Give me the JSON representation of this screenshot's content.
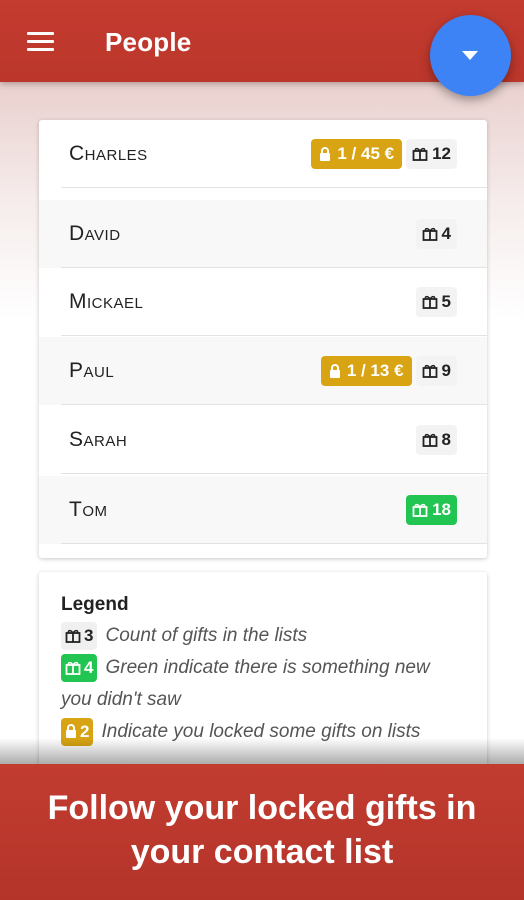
{
  "appbar": {
    "title": "People",
    "menu_icon": "menu-icon",
    "fab_icon": "dropdown-arrow-icon"
  },
  "colors": {
    "appbar": "#c0392b",
    "fab": "#3d83f5",
    "lock": "#d8a413",
    "new": "#22c452"
  },
  "people": [
    {
      "name": "Charles",
      "locked": "1 / 45 €",
      "gifts": "12",
      "is_new": false
    },
    {
      "name": "David",
      "locked": null,
      "gifts": "4",
      "is_new": false
    },
    {
      "name": "Mickael",
      "locked": null,
      "gifts": "5",
      "is_new": false
    },
    {
      "name": "Paul",
      "locked": "1 / 13 €",
      "gifts": "9",
      "is_new": false
    },
    {
      "name": "Sarah",
      "locked": null,
      "gifts": "8",
      "is_new": false
    },
    {
      "name": "Tom",
      "locked": null,
      "gifts": "18",
      "is_new": true
    }
  ],
  "legend": {
    "title": "Legend",
    "items": [
      {
        "badge": "3",
        "text": "Count of gifts in the lists"
      },
      {
        "badge": "4",
        "text": "Green indicate there is something new you didn't saw"
      },
      {
        "badge": "2",
        "text": "Indicate you locked some gifts on lists"
      }
    ]
  },
  "footer": {
    "line1": "Follow your locked gifts in",
    "line2": "your contact list"
  }
}
